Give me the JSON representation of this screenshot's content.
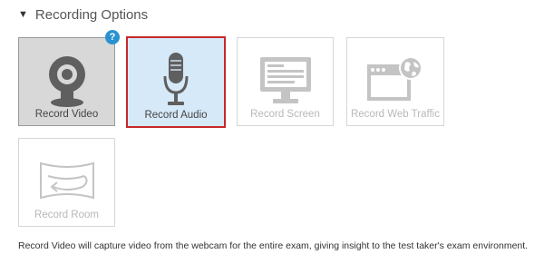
{
  "section": {
    "caret": "▼",
    "title": "Recording Options"
  },
  "options": [
    {
      "label": "Record Video",
      "icon": "webcam-icon",
      "state": "selected"
    },
    {
      "label": "Record Audio",
      "icon": "microphone-icon",
      "state": "focused"
    },
    {
      "label": "Record Screen",
      "icon": "monitor-icon",
      "state": "disabled"
    },
    {
      "label": "Record Web Traffic",
      "icon": "browser-globe-icon",
      "state": "disabled"
    },
    {
      "label": "Record Room",
      "icon": "room-panorama-icon",
      "state": "disabled"
    }
  ],
  "help_badge": "?",
  "description": "Record Video will capture video from the webcam for the entire exam, giving insight to the test taker's exam environment.",
  "colors": {
    "selected_bg": "#d8d8d8",
    "focused_bg": "#d6e9f8",
    "focus_border": "#c62828",
    "help_badge": "#2a92d0",
    "disabled_icon": "#c4c4c4"
  }
}
